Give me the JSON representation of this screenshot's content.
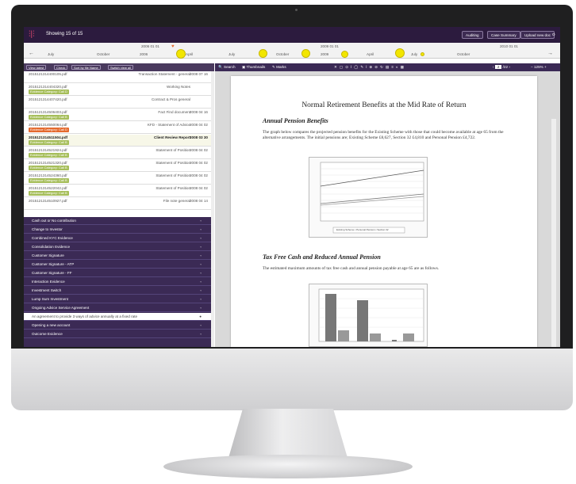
{
  "app": {
    "showing": "Showing 15 of 15",
    "buttons": [
      "Auditing",
      "Case Summary",
      "Upload new doc",
      "O"
    ]
  },
  "timeline": {
    "date_labels": [
      "2006 01 01",
      "2009 01 01",
      "2010 01 01"
    ],
    "month_labels": [
      "July",
      "October",
      "2006",
      "April",
      "July",
      "October",
      "2009",
      "April",
      "July",
      "October"
    ]
  },
  "left_toolbar": [
    "View latest",
    "Check",
    "Sort by file Name",
    "Switch view all"
  ],
  "files": [
    {
      "name": "2015121314400105.pdf",
      "desc": "Transaction Statement - general",
      "date": "2008 07 16",
      "tag": ""
    },
    {
      "name": "2015121314404320.pdf",
      "desc": "Working Notes",
      "date": "",
      "tag": "Evidence Category: Call D"
    },
    {
      "name": "2015121314407420.pdf",
      "desc": "Contract & Pros general",
      "date": "",
      "tag": ""
    },
    {
      "name": "2015121314506403.pdf",
      "desc": "Fact Find document",
      "date": "2008 04 16",
      "tag": "Evidence Category: Call B"
    },
    {
      "name": "2015121314550064.pdf",
      "desc": "KFD - Statement of Advice",
      "date": "2008 04 02",
      "tag": "Evidence Category: Call D"
    },
    {
      "name": "2015121314511504.pdf",
      "desc": "Client Review Report",
      "date": "2008 03 30",
      "tag": "Evidence Category: Call B"
    },
    {
      "name": "2015121314521924.pdf",
      "desc": "Statement of Position",
      "date": "2008 04 02",
      "tag": "Evidence Category: Call B"
    },
    {
      "name": "2015121314521320.pdf",
      "desc": "Statement of Position",
      "date": "2008 04 02",
      "tag": "Evidence Category: Call B"
    },
    {
      "name": "2015121314524360.pdf",
      "desc": "Statement of Position",
      "date": "2008 04 02",
      "tag": "Evidence Category: Call B"
    },
    {
      "name": "2015121314522042.pdf",
      "desc": "Statement of Position",
      "date": "2008 04 02",
      "tag": "Evidence Category: Call B"
    },
    {
      "name": "2015121314510927.pdf",
      "desc": "File note general",
      "date": "2008 04 14",
      "tag": ""
    }
  ],
  "categories": [
    "Cash out or No contribution",
    "Change to Investor",
    "Combined KYC Evidence",
    "Consolidation Evidence",
    "Customer Signature",
    "Customer Signature - ATP",
    "Customer Signature - FF",
    "Interaction Evidence",
    "Investment Switch",
    "Lump Sum Investment",
    "Ongoing Advice Service Agreement",
    "An agreement to provide 3 ways of advice annually at a fixed rate",
    "Opening a new account",
    "Outcome Evidence"
  ],
  "viewer_toolbar": {
    "search": "Search",
    "thumbnails": "Thumbnails",
    "marks": "Marks",
    "page": "2",
    "zoom": "125%"
  },
  "document": {
    "title": "Normal Retirement Benefits at the Mid Rate of Return",
    "h_pension": "Annual Pension Benefits",
    "para1": "The graph below compares the projected pension benefits for the Existing Scheme with those that could become available at age 65 from the alternative arrangements. The initial pensions are; Existing Scheme £8,627, Section 32 £4,810 and Personal Pension £4,722.",
    "h_tax": "Tax Free Cash and Reduced Annual Pension",
    "para2": "The estimated maximum amounts of tax free cash and annual pension payable at age 65 are as follows.",
    "legend": [
      "Existing Scheme",
      "Personal Pension",
      "Section 32"
    ]
  },
  "colors": {
    "accent": "#2c1b3e",
    "tag": "#a6be5a",
    "bubble": "#f2e600"
  }
}
